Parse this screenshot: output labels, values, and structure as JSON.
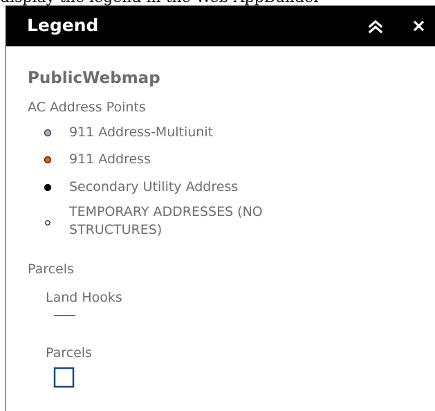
{
  "clipped_top_text": "display the legend in the Web AppBuilder",
  "header": {
    "title": "Legend"
  },
  "map": {
    "title": "PublicWebmap"
  },
  "layers": [
    {
      "title": "AC Address Points",
      "items": [
        {
          "label": "911 Address-Multiunit",
          "color": "#9fb4c3",
          "stroke": "#2e3440"
        },
        {
          "label": "911 Address",
          "color": "#e2620f",
          "stroke": "#3a1a05"
        },
        {
          "label": "Secondary Utility Address",
          "color": "#000000",
          "stroke": "#000000"
        },
        {
          "label": "TEMPORARY ADDRESSES (NO\nSTRUCTURES)",
          "color": "#ffffff",
          "stroke": "#000000"
        }
      ]
    },
    {
      "title": "Parcels",
      "sublayers": [
        {
          "title": "Land Hooks",
          "symbol": "line",
          "color": "#e8394a"
        },
        {
          "title": "Parcels",
          "symbol": "square",
          "color": "#1a4a8a"
        }
      ]
    }
  ]
}
